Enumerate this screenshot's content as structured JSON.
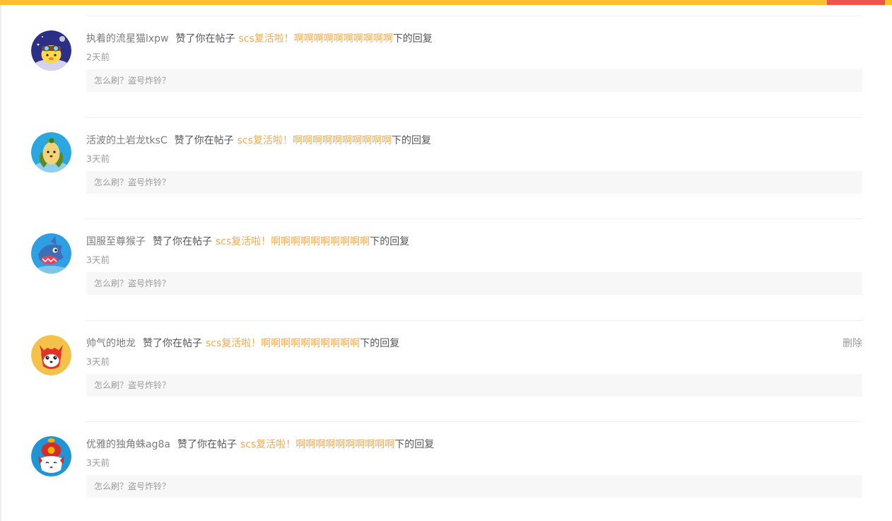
{
  "items": [
    {
      "user": "执着的流星猫lxpw",
      "action": "赞了你在帖子",
      "post": "scs复活啦！啊啊啊啊啊啊啊啊啊啊",
      "suffix": "下的回复",
      "time": "2天前",
      "quote": "怎么刷？盗号炸铃？",
      "avatar_icon": "cat-pilot-avatar-icon"
    },
    {
      "user": "活波的土岩龙tksC",
      "action": "赞了你在帖子",
      "post": "scs复活啦！啊啊啊啊啊啊啊啊啊啊",
      "suffix": "下的回复",
      "time": "3天前",
      "quote": "怎么刷？盗号炸铃？",
      "avatar_icon": "seed-creature-avatar-icon"
    },
    {
      "user": "国服至尊猴子",
      "action": "赞了你在帖子",
      "post": "scs复活啦！啊啊啊啊啊啊啊啊啊啊",
      "suffix": "下的回复",
      "time": "3天前",
      "quote": "怎么刷？盗号炸铃？",
      "avatar_icon": "blue-shark-avatar-icon"
    },
    {
      "user": "帅气的地龙",
      "action": "赞了你在帖子",
      "post": "scs复活啦！啊啊啊啊啊啊啊啊啊啊",
      "suffix": "下的回复",
      "time": "3天前",
      "quote": "怎么刷？盗号炸铃？",
      "avatar_icon": "red-fox-avatar-icon",
      "delete_label": "删除"
    },
    {
      "user": "优雅的独角蛛ag8a",
      "action": "赞了你在帖子",
      "post": "scs复活啦！啊啊啊啊啊啊啊啊啊啊",
      "suffix": "下的回复",
      "time": "3天前",
      "quote": "怎么刷？盗号炸铃？",
      "avatar_icon": "fortune-fox-avatar-icon"
    }
  ],
  "colors": {
    "top_bar": "#fbc02d",
    "top_bar_accent": "#ef5350",
    "post_link": "#f6a84f",
    "quote_bg": "#f7f7f7"
  }
}
